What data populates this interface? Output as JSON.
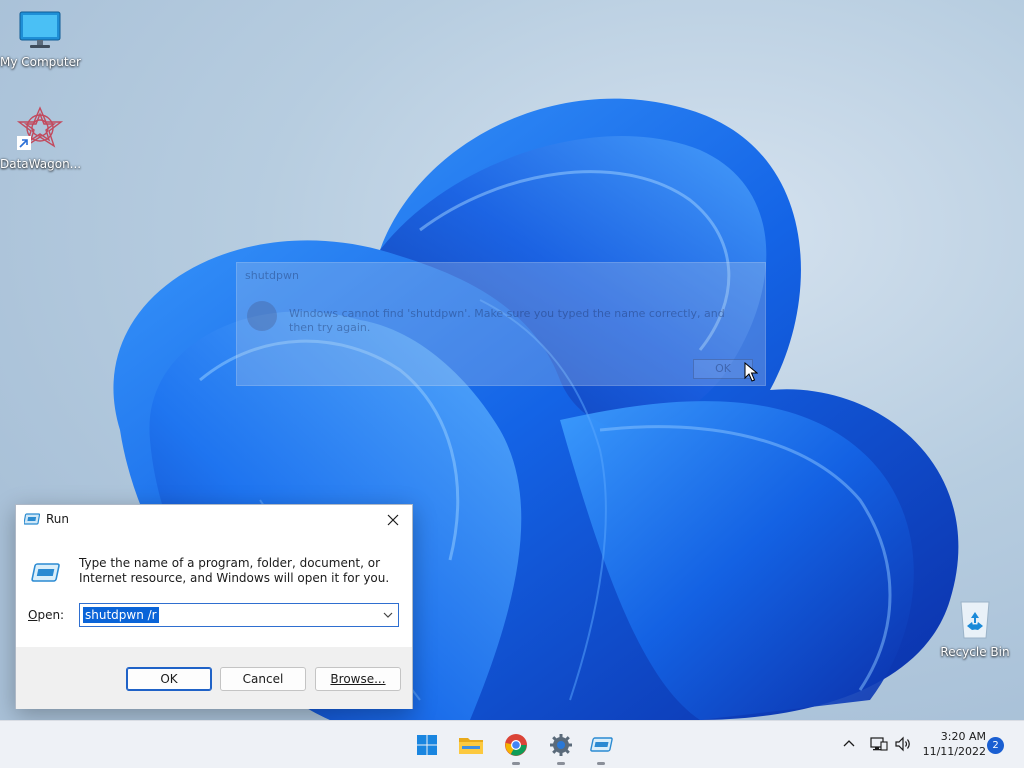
{
  "desktop": {
    "icons": [
      {
        "label": "My Computer",
        "icon": "monitor-icon"
      },
      {
        "label": "DataWagon...",
        "icon": "datawagon-icon"
      },
      {
        "label": "Recycle Bin",
        "icon": "recycle-bin-icon"
      }
    ]
  },
  "error_dialog": {
    "title": "shutdpwn",
    "message": "Windows cannot find 'shutdpwn'. Make sure you typed the name correctly, and then try again.",
    "ok_label": "OK",
    "icon": "error-icon"
  },
  "run_dialog": {
    "title": "Run",
    "description": "Type the name of a program, folder, document, or Internet resource, and Windows will open it for you.",
    "open_label_prefix": "",
    "open_label_access": "O",
    "open_label_rest": "pen:",
    "input_value": "shutdpwn /r",
    "ok_label": "OK",
    "cancel_label": "Cancel",
    "browse_label": "Browse...",
    "icons": [
      "run-icon",
      "close-icon",
      "chevron-down-icon"
    ]
  },
  "taskbar": {
    "apps": [
      {
        "name": "start",
        "icon": "windows-logo-icon"
      },
      {
        "name": "file-explorer",
        "icon": "folder-icon"
      },
      {
        "name": "chrome",
        "icon": "chrome-icon"
      },
      {
        "name": "settings",
        "icon": "gear-icon"
      },
      {
        "name": "run",
        "icon": "run-icon"
      }
    ],
    "clock": {
      "time": "3:20 AM",
      "date": "11/11/2022"
    },
    "notification_count": "2"
  },
  "colors": {
    "accent": "#0a64d8",
    "taskbar_bg": "#eef1f6",
    "dialog_footer": "#f0f0f0"
  }
}
